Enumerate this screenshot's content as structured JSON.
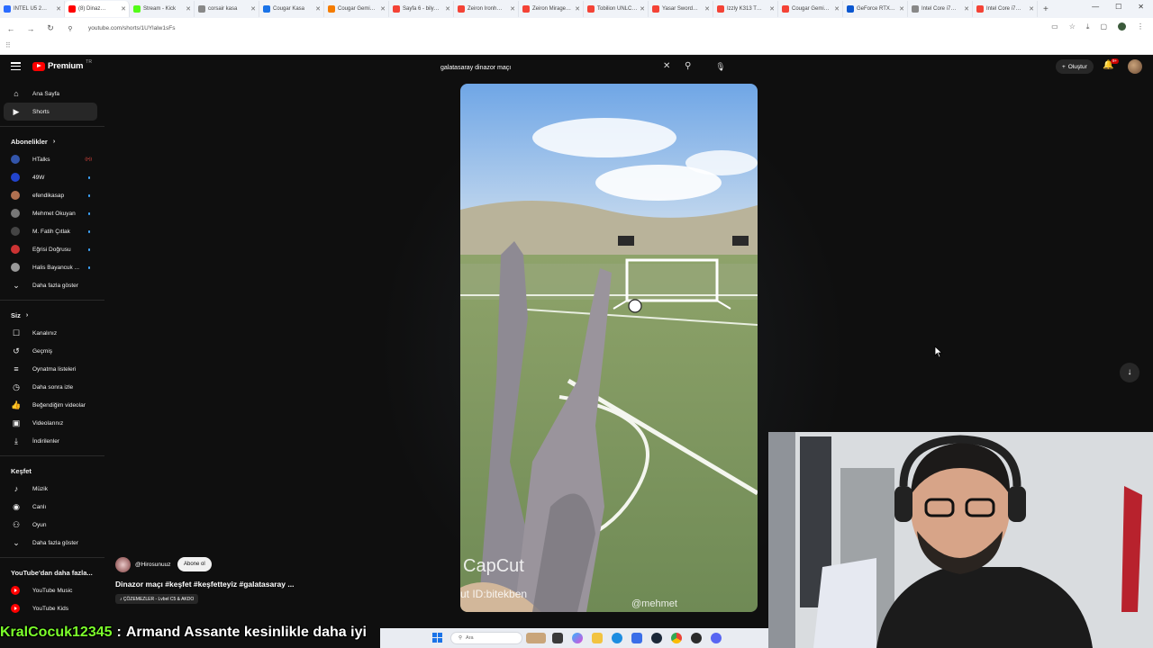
{
  "browser": {
    "tabs": [
      {
        "label": "INTEL U5 2…",
        "color": "#2b6cff",
        "active": false
      },
      {
        "label": "(8) Dinaz…",
        "color": "#ff0000",
        "active": true
      },
      {
        "label": "Stream - Kick",
        "color": "#53fc18",
        "active": false
      },
      {
        "label": "corsair kasa",
        "color": "#888888",
        "active": false
      },
      {
        "label": "Cougar Kasa",
        "color": "#1a73e8",
        "active": false
      },
      {
        "label": "Cougar Gemi…",
        "color": "#f57c00",
        "active": false
      },
      {
        "label": "Sayfa 6 - bily…",
        "color": "#f44336",
        "active": false
      },
      {
        "label": "Zeiron Ironh…",
        "color": "#f44336",
        "active": false
      },
      {
        "label": "Zeiron Mirage…",
        "color": "#f44336",
        "active": false
      },
      {
        "label": "Tobilion UNLC…",
        "color": "#f44336",
        "active": false
      },
      {
        "label": "Yasar Sword…",
        "color": "#f44336",
        "active": false
      },
      {
        "label": "Izzly K313 T…",
        "color": "#f44336",
        "active": false
      },
      {
        "label": "Cougar Gemi…",
        "color": "#f44336",
        "active": false
      },
      {
        "label": "GeForce RTX…",
        "color": "#0b57d0",
        "active": false
      },
      {
        "label": "Intel Core i7…",
        "color": "#888888",
        "active": false
      },
      {
        "label": "Intel Core i7…",
        "color": "#f44336",
        "active": false
      }
    ],
    "url": "youtube.com/shorts/1UYlalw1sFs"
  },
  "header": {
    "logo_word": "Premium",
    "logo_tr": "TR",
    "search_query": "galatasaray dinazor maçı",
    "create_label": "Oluştur",
    "notif_count": "9+"
  },
  "sidebar": {
    "main": [
      {
        "label": "Ana Sayfa",
        "icon": "home-icon",
        "glyph": "⌂"
      },
      {
        "label": "Shorts",
        "icon": "shorts-icon",
        "glyph": "▶"
      }
    ],
    "subs_title": "Abonelikler",
    "subs": [
      {
        "label": "HTalks",
        "color": "#3355aa",
        "badge": "live"
      },
      {
        "label": "49W",
        "color": "#2244cc",
        "badge": "dot"
      },
      {
        "label": "efendikasap",
        "color": "#b07050",
        "badge": "dot"
      },
      {
        "label": "Mehmet Okuyan",
        "color": "#777777",
        "badge": "dot"
      },
      {
        "label": "M. Fatih Çıtlak",
        "color": "#444444",
        "badge": "dot"
      },
      {
        "label": "Eğrisi Doğrusu",
        "color": "#cc3333",
        "badge": "dot"
      },
      {
        "label": "Halis Bayancuk ...",
        "color": "#999999",
        "badge": "dot"
      }
    ],
    "subs_more": "Daha fazla göster",
    "you_title": "Siz",
    "you": [
      {
        "label": "Kanalınız",
        "icon": "channel-icon",
        "glyph": "☐"
      },
      {
        "label": "Geçmiş",
        "icon": "history-icon",
        "glyph": "↺"
      },
      {
        "label": "Oynatma listeleri",
        "icon": "playlists-icon",
        "glyph": "≡"
      },
      {
        "label": "Daha sonra izle",
        "icon": "watch-later-icon",
        "glyph": "◷"
      },
      {
        "label": "Beğendiğim videolar",
        "icon": "like-icon",
        "glyph": "👍"
      },
      {
        "label": "Videolarınız",
        "icon": "your-videos-icon",
        "glyph": "▣"
      },
      {
        "label": "İndirilenler",
        "icon": "download-icon",
        "glyph": "⤓"
      }
    ],
    "explore_title": "Keşfet",
    "explore": [
      {
        "label": "Müzik",
        "icon": "music-icon",
        "glyph": "♪"
      },
      {
        "label": "Canlı",
        "icon": "live-icon",
        "glyph": "◉"
      },
      {
        "label": "Oyun",
        "icon": "gaming-icon",
        "glyph": "⚇"
      }
    ],
    "explore_more": "Daha fazla göster",
    "more_title": "YouTube'dan daha fazla...",
    "more": [
      {
        "label": "YouTube Music"
      },
      {
        "label": "YouTube Kids"
      }
    ]
  },
  "short": {
    "channel": "@Hirosunuuz",
    "subscribe_label": "Abone ol",
    "title": "Dinazor maçı #keşfet #keşfetteyiz #galatasaray ...",
    "music": "♪ ÇÖZEMEZLER - Lvbel C5 & AKDO",
    "watermark_capcut": "CapCut",
    "watermark_id": "ut ID:bitekben",
    "watermark_user": "@mehmet"
  },
  "chat": {
    "user": "KralCocuk12345",
    "separator": ":",
    "message": "Armand Assante kesinlikle daha iyi"
  },
  "taskbar": {
    "search_label": "Ara"
  },
  "colors": {
    "yt_red": "#ff0000",
    "bg": "#0f0f0f",
    "chat_user": "#7cff2b"
  }
}
